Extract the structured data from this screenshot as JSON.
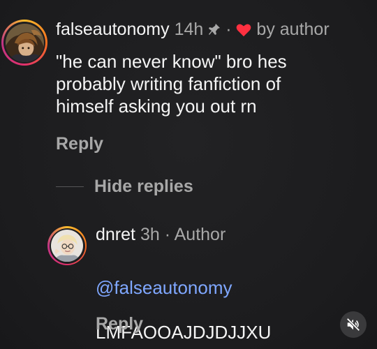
{
  "comment": {
    "username": "falseautonomy",
    "time": "14h",
    "pin_icon": "pin-icon",
    "separator": "·",
    "heart_icon": "heart-icon",
    "liked_by": "by author",
    "body": "\"he can never know\" bro hes\nprobably writing fanfiction of\nhimself asking you out rn",
    "reply_label": "Reply",
    "hide_replies_label": "Hide replies"
  },
  "reply": {
    "username": "dnret",
    "time": "3h",
    "separator": "·",
    "role": "Author",
    "mention": "@falseautonomy",
    "body": "LMFAOOAJDJDJJXU",
    "reply_label": "Reply"
  },
  "controls": {
    "mute_icon": "speaker-muted-icon"
  },
  "colors": {
    "background": "#1e1e20",
    "primary_text": "#f5f5f5",
    "secondary_text": "#a8a8a8",
    "mention": "#7fa7ff",
    "heart": "#ff3040"
  }
}
